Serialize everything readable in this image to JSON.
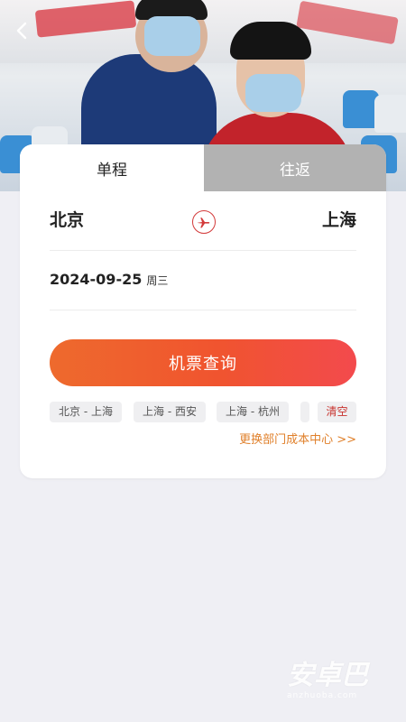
{
  "tabs": {
    "single": "单程",
    "round": "往返"
  },
  "route": {
    "from": "北京",
    "to": "上海"
  },
  "date": {
    "value": "2024-09-25",
    "weekday": "周三"
  },
  "search_button": "机票查询",
  "history": [
    {
      "label": "北京 - 上海"
    },
    {
      "label": "上海 - 西安"
    },
    {
      "label": "上海 - 杭州"
    },
    {
      "label": ""
    }
  ],
  "clear_label": "清空",
  "dept_link": "更换部门成本中心 >>",
  "watermark": {
    "main": "安卓巴",
    "sub": "anzhuoba.com"
  },
  "colors": {
    "accent": "#f0542f",
    "link": "#e0802b",
    "clear": "#c8332e"
  }
}
